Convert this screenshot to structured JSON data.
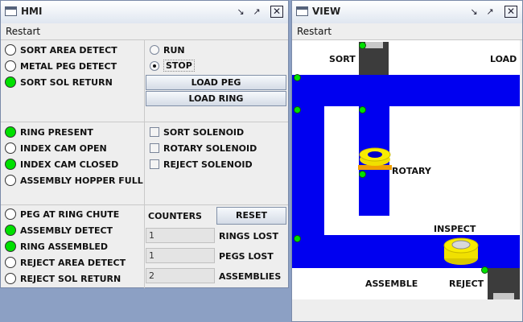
{
  "hmi": {
    "title": "HMI",
    "menu": "Restart",
    "indicators_group1": [
      {
        "label": "SORT AREA DETECT",
        "on": false
      },
      {
        "label": "METAL PEG DETECT",
        "on": false
      },
      {
        "label": "SORT SOL RETURN",
        "on": true
      }
    ],
    "indicators_group2": [
      {
        "label": "RING PRESENT",
        "on": true
      },
      {
        "label": "INDEX CAM OPEN",
        "on": false
      },
      {
        "label": "INDEX CAM CLOSED",
        "on": true
      },
      {
        "label": "ASSEMBLY HOPPER FULL",
        "on": false
      }
    ],
    "indicators_group3": [
      {
        "label": "PEG AT RING CHUTE",
        "on": false
      },
      {
        "label": "ASSEMBLY DETECT",
        "on": true
      },
      {
        "label": "RING ASSEMBLED",
        "on": true
      },
      {
        "label": "REJECT AREA DETECT",
        "on": false
      },
      {
        "label": "REJECT SOL RETURN",
        "on": false
      }
    ],
    "mode": {
      "run_label": "RUN",
      "stop_label": "STOP",
      "selected": "STOP"
    },
    "load_peg_label": "LOAD PEG",
    "load_ring_label": "LOAD RING",
    "solenoids": [
      {
        "label": "SORT SOLENOID",
        "checked": false
      },
      {
        "label": "ROTARY SOLENOID",
        "checked": false
      },
      {
        "label": "REJECT SOLENOID",
        "checked": false
      }
    ],
    "counters_label": "COUNTERS",
    "reset_label": "RESET",
    "counters": [
      {
        "value": "1",
        "label": "RINGS LOST"
      },
      {
        "value": "1",
        "label": "PEGS LOST"
      },
      {
        "value": "2",
        "label": "ASSEMBLIES"
      }
    ]
  },
  "view": {
    "title": "VIEW",
    "menu": "Restart",
    "labels": {
      "sort": "SORT",
      "load": "LOAD",
      "rotary": "ROTARY",
      "inspect": "INSPECT",
      "assemble": "ASSEMBLE",
      "reject": "REJECT"
    },
    "colors": {
      "conveyor": "#0000f0",
      "sensor": "#00e000",
      "ring": "#f0e000",
      "peg": "#d8d8d8"
    }
  },
  "icons": {
    "app": "window-icon",
    "minimize": "minimize-icon",
    "maximize": "maximize-icon",
    "close": "close-icon"
  }
}
